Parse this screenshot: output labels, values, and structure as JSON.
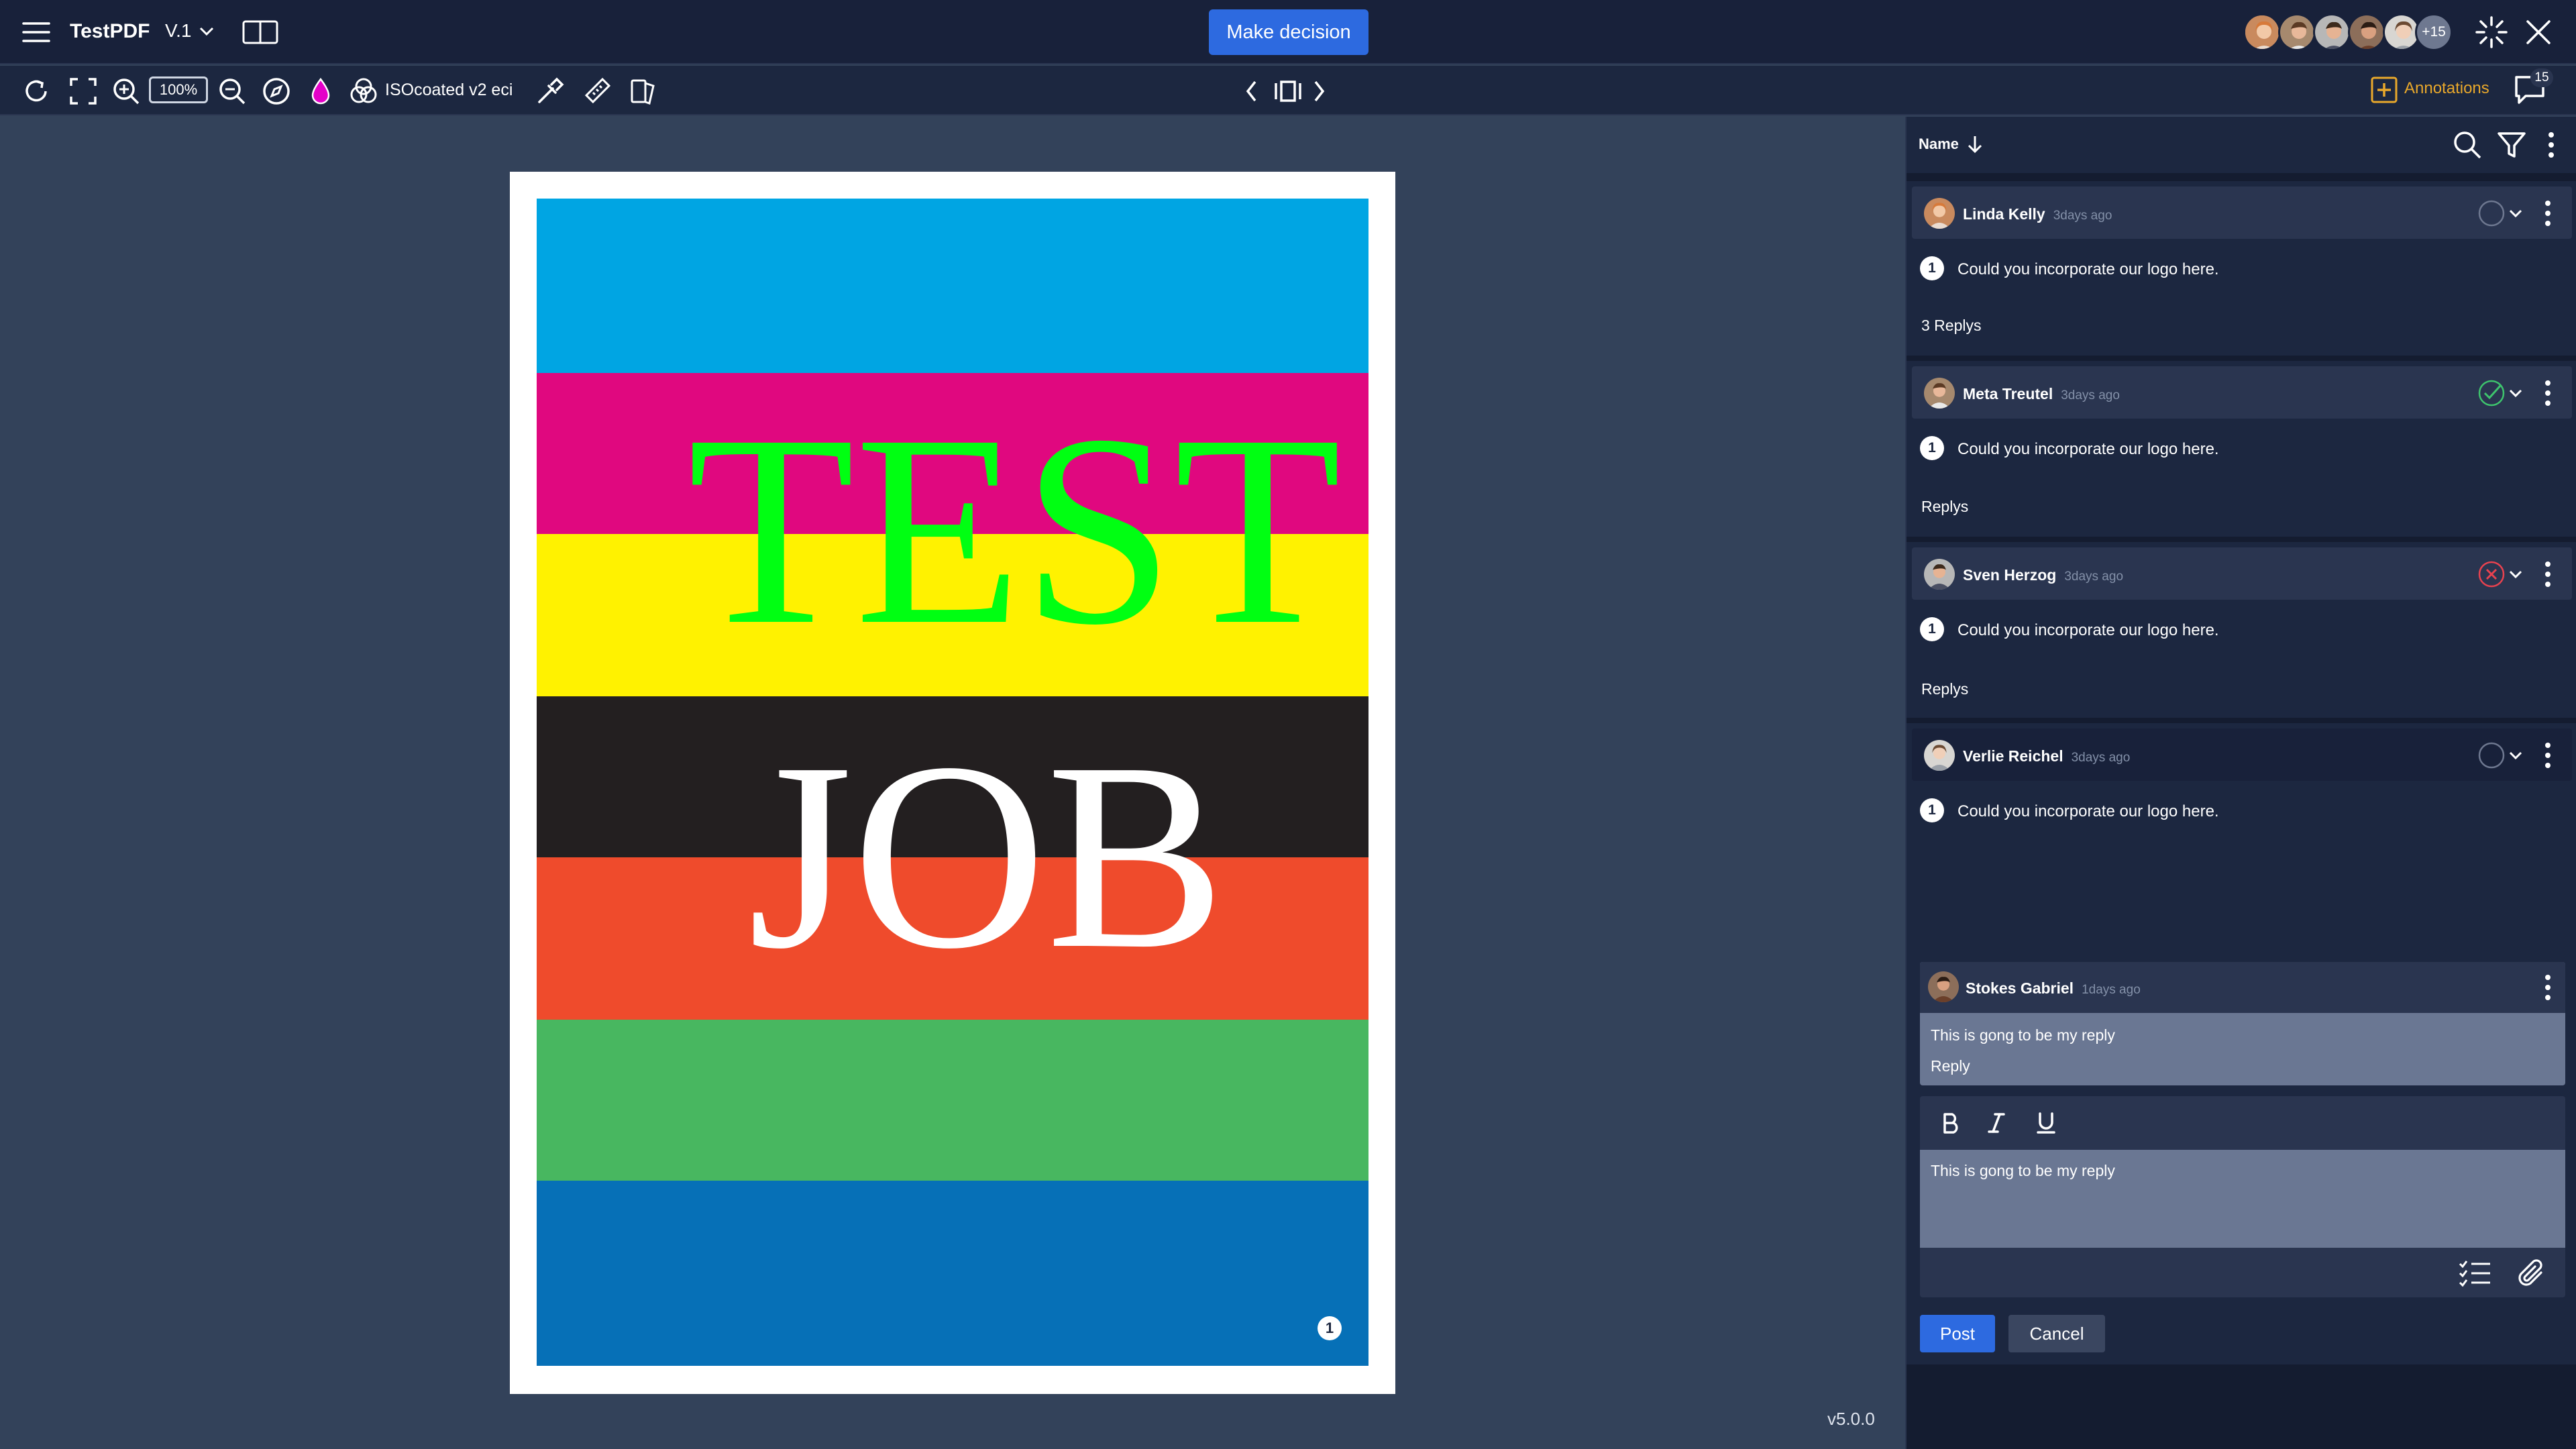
{
  "header": {
    "app_title": "TestPDF",
    "version": "V.1",
    "make_decision_label": "Make decision",
    "more_users_label": "+15"
  },
  "toolbar": {
    "zoom_level": "100%",
    "color_profile": "ISOcoated v2 eci",
    "annotations_label": "Annotations",
    "comment_count": "15"
  },
  "document": {
    "line1": "TEST",
    "line2": "JOB",
    "pin_number": "1",
    "stripe_colors": [
      "#00a5e3",
      "#e0087f",
      "#fff200",
      "#231f20",
      "#ef4b2c",
      "#48b760",
      "#0670b7"
    ]
  },
  "app_version": "v5.0.0",
  "panel": {
    "sort_label": "Name",
    "comments": [
      {
        "author": "Linda Kelly",
        "time": "3days ago",
        "number": "1",
        "text": "Could you incorporate our logo here.",
        "replies": "3 Replys",
        "status": "open"
      },
      {
        "author": "Meta Treutel",
        "time": "3days ago",
        "number": "1",
        "text": "Could you incorporate our logo here.",
        "replies": "Replys",
        "status": "approved"
      },
      {
        "author": "Sven Herzog",
        "time": "3days ago",
        "number": "1",
        "text": "Could you incorporate our logo here.",
        "replies": "Replys",
        "status": "rejected"
      },
      {
        "author": "Verlie Reichel",
        "time": "3days ago",
        "number": "1",
        "text": "Could you incorporate our logo here.",
        "status": "open"
      }
    ],
    "reply": {
      "author": "Stokes Gabriel",
      "time": "1days ago",
      "text": "This is gong to be my reply",
      "reply_label": "Reply"
    },
    "editor": {
      "text": "This is gong to be my reply",
      "post_label": "Post",
      "cancel_label": "Cancel"
    }
  },
  "colors": {
    "accent": "#2d6ae0",
    "approved": "#3ec46d",
    "rejected": "#e8424f",
    "annotations": "#e9a82b",
    "test_text": "#00ff12"
  }
}
